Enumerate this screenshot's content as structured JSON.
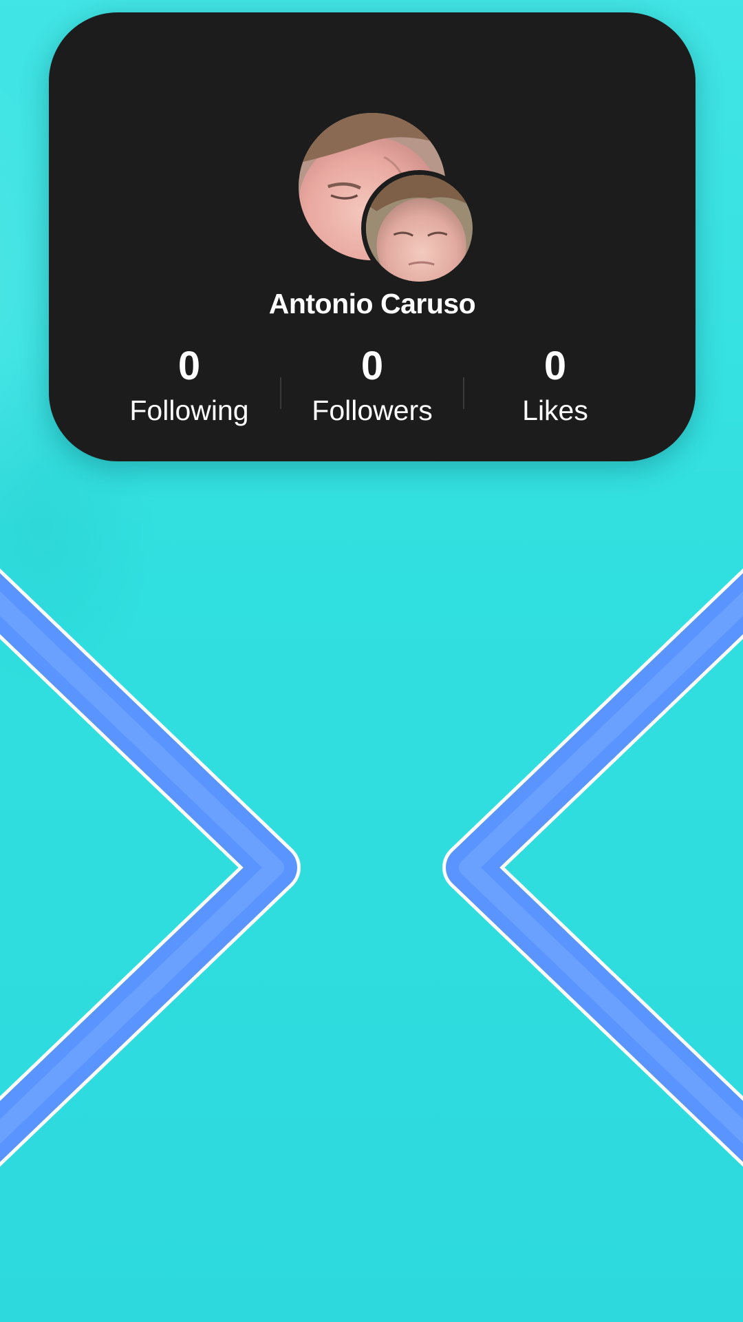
{
  "profile": {
    "username": "Antonio Caruso",
    "avatars": [
      {
        "icon": "profile-photo-icon",
        "description_role": "primary avatar"
      },
      {
        "icon": "profile-photo-icon",
        "description_role": "secondary avatar"
      }
    ],
    "stats": [
      {
        "value": "0",
        "label": "Following"
      },
      {
        "value": "0",
        "label": "Followers"
      },
      {
        "value": "0",
        "label": "Likes"
      }
    ]
  },
  "navigation": {
    "left_icon": "chevron-right-icon",
    "right_icon": "chevron-left-icon"
  },
  "colors": {
    "background": "#31e0e0",
    "card": "#1c1c1c",
    "text": "#ffffff",
    "chevron": "#5a95ff",
    "chevron_outline": "#ffffff"
  }
}
